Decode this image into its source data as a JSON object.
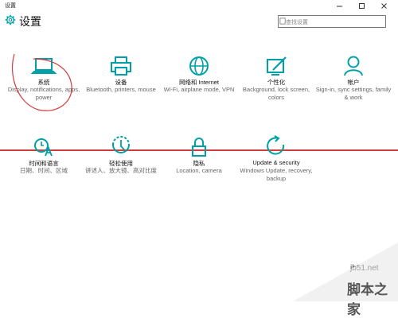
{
  "window": {
    "title": "设置"
  },
  "page": {
    "title": "设置"
  },
  "search": {
    "placeholder": "查找设置"
  },
  "categories": [
    {
      "name": "系统",
      "desc": "Display, notifications, apps, power",
      "icon": "laptop-icon"
    },
    {
      "name": "设备",
      "desc": "Bluetooth, printers, mouse",
      "icon": "printer-icon"
    },
    {
      "name": "网络和 Internet",
      "desc": "Wi-Fi, airplane mode, VPN",
      "icon": "globe-icon"
    },
    {
      "name": "个性化",
      "desc": "Background, lock screen, colors",
      "icon": "paint-icon"
    },
    {
      "name": "帐户",
      "desc": "Sign-in, sync settings, family & work",
      "icon": "person-icon"
    },
    {
      "name": "时间和语言",
      "desc": "日期、时间、区域",
      "icon": "time-language-icon"
    },
    {
      "name": "轻松使用",
      "desc": "讲述人、放大镜、高对比度",
      "icon": "ease-of-access-icon"
    },
    {
      "name": "隐私",
      "desc": "Location, camera",
      "icon": "lock-icon"
    },
    {
      "name": "Update & security",
      "desc": "Windows Update, recovery, backup",
      "icon": "refresh-icon"
    }
  ],
  "watermark": {
    "site": "jb51.net",
    "brand": "脚本之家"
  },
  "colors": {
    "accent": "#00a0a8",
    "annotation": "#d23c3c"
  }
}
